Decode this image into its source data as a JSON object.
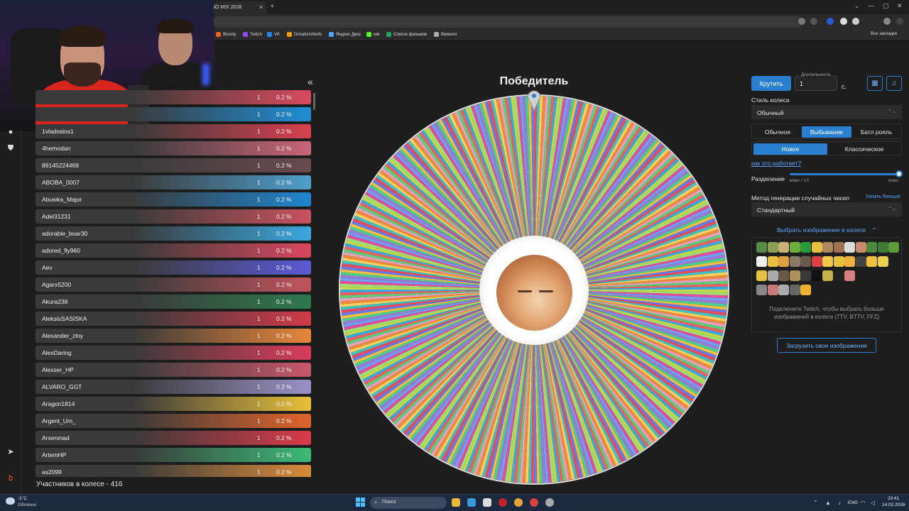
{
  "browser": {
    "active_tab_title": "INO MIX 2026",
    "bookmarks": [
      {
        "label": "Boosty",
        "color": "#f15f2c"
      },
      {
        "label": "Twitch",
        "color": "#9146ff"
      },
      {
        "label": "VK",
        "color": "#2787f5"
      },
      {
        "label": "DonationAlerts",
        "color": "#f59c07"
      },
      {
        "label": "Яндекс Диск",
        "color": "#4aa3ff"
      },
      {
        "label": "кик",
        "color": "#53fc18"
      },
      {
        "label": "Список фильмов",
        "color": "#22a35a"
      },
      {
        "label": "Викинги",
        "color": "#aaaaaa"
      }
    ],
    "all_bookmarks": "Все закладки"
  },
  "wheel": {
    "title": "Победитель",
    "segment_count": 416
  },
  "participants": {
    "total_label": "Участников в колесе - 416",
    "rows": [
      {
        "name": "",
        "count": "1",
        "pct": "0.2 %",
        "color": "#d9495e"
      },
      {
        "name": "",
        "count": "1",
        "pct": "0.2 %",
        "color": "#1e8fd6"
      },
      {
        "name": "1vladosios1",
        "count": "1",
        "pct": "0.2 %",
        "color": "#d94050"
      },
      {
        "name": "4hemodan",
        "count": "1",
        "pct": "0.2 %",
        "color": "#c9657a"
      },
      {
        "name": "89145224469",
        "count": "1",
        "pct": "0.2 %",
        "color": "#6a4a4e"
      },
      {
        "name": "ABOBA_0007",
        "count": "1",
        "pct": "0.2 %",
        "color": "#4fa0cf"
      },
      {
        "name": "Abuwka_Major",
        "count": "1",
        "pct": "0.2 %",
        "color": "#1f86cf"
      },
      {
        "name": "Adel31231",
        "count": "1",
        "pct": "0.2 %",
        "color": "#c9525e"
      },
      {
        "name": "adorable_boar30",
        "count": "1",
        "pct": "0.2 %",
        "color": "#3aa8e0"
      },
      {
        "name": "adored_fly960",
        "count": "1",
        "pct": "0.2 %",
        "color": "#d9485e"
      },
      {
        "name": "Aev",
        "count": "1",
        "pct": "0.2 %",
        "color": "#5a5ad8"
      },
      {
        "name": "Agarx5200",
        "count": "1",
        "pct": "0.2 %",
        "color": "#c2545e"
      },
      {
        "name": "Akura238",
        "count": "1",
        "pct": "0.2 %",
        "color": "#2e7a4e"
      },
      {
        "name": "AleksisSASISKA",
        "count": "1",
        "pct": "0.2 %",
        "color": "#d23a4a"
      },
      {
        "name": "Alexander_zloy",
        "count": "1",
        "pct": "0.2 %",
        "color": "#e8863a"
      },
      {
        "name": "AlexDaring",
        "count": "1",
        "pct": "0.2 %",
        "color": "#d93c5a"
      },
      {
        "name": "Alexser_HP",
        "count": "1",
        "pct": "0.2 %",
        "color": "#c9576a"
      },
      {
        "name": "ALVARO_GGT",
        "count": "1",
        "pct": "0.2 %",
        "color": "#9a92c8"
      },
      {
        "name": "Aragon1814",
        "count": "1",
        "pct": "0.2 %",
        "color": "#e8c03a"
      },
      {
        "name": "Argent_Um_",
        "count": "1",
        "pct": "0.2 %",
        "color": "#e0642c"
      },
      {
        "name": "Arsenmad",
        "count": "1",
        "pct": "0.2 %",
        "color": "#d93a48"
      },
      {
        "name": "ArtemHP",
        "count": "1",
        "pct": "0.2 %",
        "color": "#3cba78"
      },
      {
        "name": "as2099",
        "count": "1",
        "pct": "0.2 %",
        "color": "#d98a3a"
      }
    ]
  },
  "controls": {
    "spin_label": "Крутить",
    "duration_label": "Длительность",
    "duration_value": "1",
    "duration_unit": "с.",
    "wheel_style_label": "Стиль колеса",
    "wheel_style_value": "Обычный",
    "modes": [
      "Обычное",
      "Выбывание",
      "Батл рояль"
    ],
    "active_mode": "Выбывание",
    "sub_modes": [
      "Новое",
      "Классическое"
    ],
    "active_sub_mode": "Новое",
    "how_link": "как это работает?",
    "split_label": "Разделение",
    "slider_min": "макс / 10",
    "slider_max": "макс",
    "slider_fraction": 1.0,
    "rng_label": "Метод генерации случайных чисел",
    "rng_link": "Узнать больше",
    "rng_value": "Стандартный",
    "image_toggle": "Выбрать изображение в колесе",
    "twitch_note": "Подключите Twitch, чтобы выбрать больше изображений в колесе (7TV, BTTV, FFZ)",
    "upload_label": "Загрузить свое изображение"
  },
  "taskbar": {
    "weather_temp": "-1°C",
    "weather_desc": "Облачно",
    "search_placeholder": "Поиск",
    "lang": "ENG",
    "time": "23:41",
    "date": "14.02.2026"
  },
  "colors": {
    "accent": "#2a7fd1",
    "link": "#5aa6ff"
  }
}
